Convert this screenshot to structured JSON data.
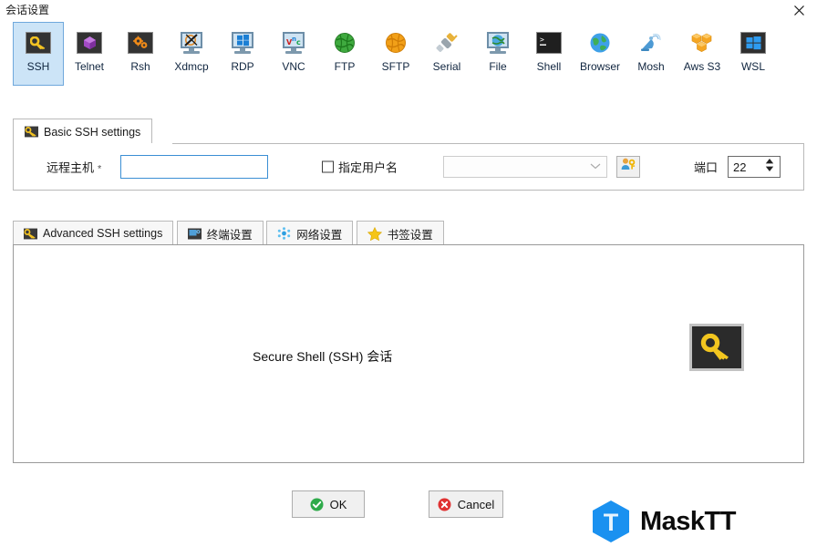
{
  "window": {
    "title": "会话设置",
    "close_icon": "close-icon"
  },
  "protocol_toolbar": {
    "selected": "SSH",
    "items": [
      {
        "label": "SSH",
        "icon": "key-icon"
      },
      {
        "label": "Telnet",
        "icon": "purple-gem-icon"
      },
      {
        "label": "Rsh",
        "icon": "orange-gears-icon"
      },
      {
        "label": "Xdmcp",
        "icon": "x-monitor-icon"
      },
      {
        "label": "RDP",
        "icon": "windows-monitor-icon"
      },
      {
        "label": "VNC",
        "icon": "vnc-monitor-icon"
      },
      {
        "label": "FTP",
        "icon": "green-globe-icon"
      },
      {
        "label": "SFTP",
        "icon": "orange-globe-icon"
      },
      {
        "label": "Serial",
        "icon": "plug-icon"
      },
      {
        "label": "File",
        "icon": "globe-monitor-icon"
      },
      {
        "label": "Shell",
        "icon": "terminal-icon"
      },
      {
        "label": "Browser",
        "icon": "blue-globe-icon"
      },
      {
        "label": "Mosh",
        "icon": "satellite-dish-icon"
      },
      {
        "label": "Aws S3",
        "icon": "aws-cubes-icon"
      },
      {
        "label": "WSL",
        "icon": "windows-logo-icon"
      }
    ]
  },
  "basic_tab": {
    "label": "Basic SSH settings",
    "icon": "key-icon"
  },
  "basic_form": {
    "host_label": "远程主机",
    "host_required_mark": "*",
    "host_value": "",
    "host_placeholder": "",
    "specify_user_label": "指定用户名",
    "specify_user_checked": false,
    "username_value": "",
    "username_placeholder": "",
    "username_dropdown_icon": "chevron-down-icon",
    "user_key_button_icon": "user-key-icon",
    "port_label": "端口",
    "port_value": "22",
    "port_spinner_icon": "spinner-arrows-icon"
  },
  "secondary_tabs": {
    "active": "Advanced SSH settings",
    "items": [
      {
        "label": "Advanced SSH settings",
        "icon": "key-icon"
      },
      {
        "label": "终端设置",
        "icon": "terminal-settings-icon"
      },
      {
        "label": "网络设置",
        "icon": "network-dots-icon"
      },
      {
        "label": "书签设置",
        "icon": "star-icon"
      }
    ]
  },
  "content_panel": {
    "caption": "Secure Shell (SSH) 会话",
    "badge_icon": "large-key-icon"
  },
  "footer": {
    "ok_label": "OK",
    "ok_icon": "green-check-icon",
    "cancel_label": "Cancel",
    "cancel_icon": "red-x-icon"
  },
  "branding": {
    "mark_letter": "T",
    "name": "MaskTT",
    "mark_color": "#1a91f0"
  },
  "colors": {
    "selection_blue": "#cce4f7",
    "selection_border": "#6fa8dc",
    "focus_border": "#3b8fd4",
    "accent_key_gold": "#f5c518",
    "ok_green": "#2eaa4a",
    "cancel_red": "#e03131",
    "brand_blue": "#1a91f0"
  }
}
